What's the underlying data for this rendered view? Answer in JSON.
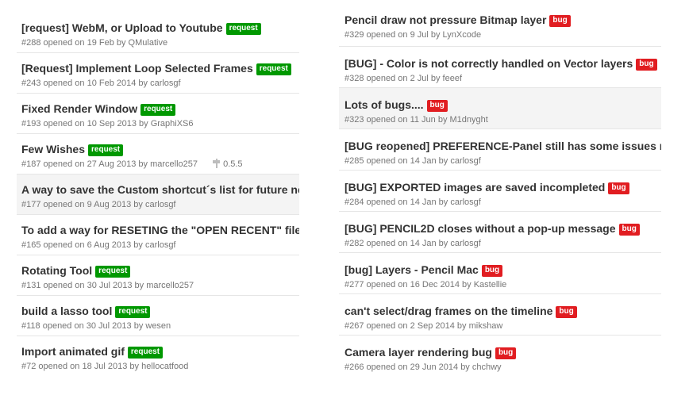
{
  "left_issues": [
    {
      "title": "[request] WebM, or Upload to Youtube",
      "label": "request",
      "meta": "#288 opened on 19 Feb by QMulative",
      "milestone": ""
    },
    {
      "title": "[Request] Implement Loop Selected Frames",
      "label": "request",
      "meta": "#243 opened on 10 Feb 2014 by carlosgf",
      "milestone": ""
    },
    {
      "title": "Fixed Render Window",
      "label": "request",
      "meta": "#193 opened on 10 Sep 2013 by GraphiXS6",
      "milestone": ""
    },
    {
      "title": "Few Wishes",
      "label": "request",
      "meta": "#187 opened on 27 Aug 2013 by marcello257",
      "milestone": "0.5.5"
    },
    {
      "title": "A way to save the Custom shortcut´s list for future needs",
      "label": "",
      "meta": "#177 opened on 9 Aug 2013 by carlosgf",
      "milestone": ""
    },
    {
      "title": "To add a way for RESETING the \"OPEN RECENT\" files list",
      "label": "",
      "meta": "#165 opened on 6 Aug 2013 by carlosgf",
      "milestone": ""
    },
    {
      "title": "Rotating Tool",
      "label": "request",
      "meta": "#131 opened on 30 Jul 2013 by marcello257",
      "milestone": ""
    },
    {
      "title": "build a lasso tool",
      "label": "request",
      "meta": "#118 opened on 30 Jul 2013 by wesen",
      "milestone": ""
    },
    {
      "title": "Import animated gif",
      "label": "request",
      "meta": "#72 opened on 18 Jul 2013 by hellocatfood",
      "milestone": ""
    }
  ],
  "right_issues": [
    {
      "title": "Pencil draw not pressure Bitmap layer",
      "label": "bug",
      "meta": "#329 opened on 9 Jul by LynXcode"
    },
    {
      "title": "[BUG] - Color is not correctly handled on Vector layers",
      "label": "bug",
      "meta": "#328 opened on 2 Jul by feeef"
    },
    {
      "title": "Lots of bugs....",
      "label": "bug",
      "meta": "#323 opened on 11 Jun by M1dnyght"
    },
    {
      "title": "[BUG reopened] PREFERENCE-Panel still has some issues regarding",
      "label": "",
      "meta": "#285 opened on 14 Jan by carlosgf"
    },
    {
      "title": "[BUG] EXPORTED images are saved incompleted",
      "label": "bug",
      "meta": "#284 opened on 14 Jan by carlosgf"
    },
    {
      "title": "[BUG] PENCIL2D closes without a pop-up message",
      "label": "bug",
      "meta": "#282 opened on 14 Jan by carlosgf"
    },
    {
      "title": "[bug] Layers - Pencil Mac",
      "label": "bug",
      "meta": "#277 opened on 16 Dec 2014 by Kastellie"
    },
    {
      "title": "can't select/drag frames on the timeline",
      "label": "bug",
      "meta": "#267 opened on 2 Sep 2014 by mikshaw"
    },
    {
      "title": "Camera layer rendering bug",
      "label": "bug",
      "meta": "#266 opened on 29 Jun 2014 by chchwy"
    }
  ],
  "colors": {
    "request_label": "#009800",
    "bug_label": "#e11d21"
  }
}
